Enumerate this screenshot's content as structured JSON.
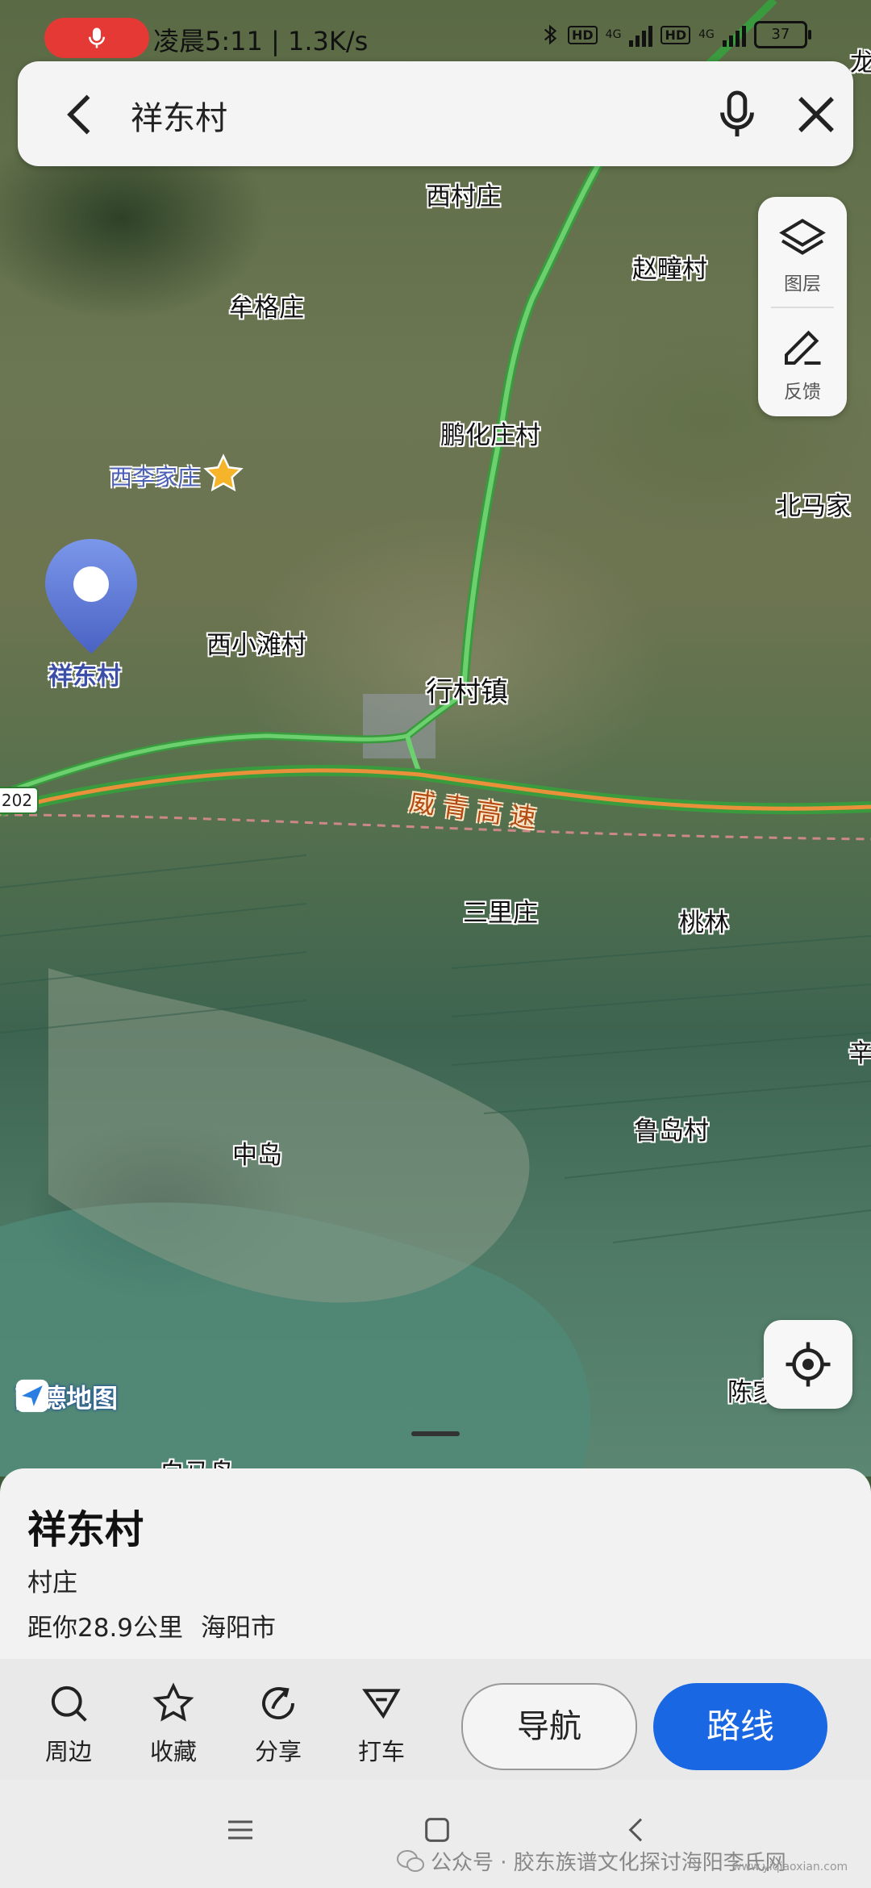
{
  "status_bar": {
    "time_speed": "凌晨5:11 | 1.3K/s",
    "hd": "HD",
    "net": "4G",
    "battery": "37"
  },
  "search": {
    "query": "祥东村",
    "icons": [
      "back-icon",
      "mic-icon",
      "close-icon"
    ]
  },
  "map_labels": {
    "xicunzhuang": "西村庄",
    "zhaotongcun": "赵疃村",
    "mougezhuang": "牟格庄",
    "penghuazhuangcun": "鹏化庄村",
    "xilijiazhuang": "西李家庄",
    "beimajia": "北马家",
    "xixiaotancun": "西小滩村",
    "xingcunzhen": "行村镇",
    "weiqinggaosu": "威青高速",
    "road_shield": "202",
    "sanlizhuang": "三里庄",
    "taolin": "桃林",
    "xin": "辛",
    "ludaocun": "鲁岛村",
    "zhongdao": "中岛",
    "chenjia": "陈家",
    "baimadao": "白马岛",
    "long": "龙",
    "pin_label": "祥东村"
  },
  "map_controls": {
    "layer_label": "图层",
    "feedback_label": "反馈",
    "amap_logo": "高德地图"
  },
  "place_card": {
    "title": "祥东村",
    "category": "村庄",
    "distance": "距你28.9公里",
    "city": "海阳市"
  },
  "actions": {
    "nearby": "周边",
    "favorite": "收藏",
    "share": "分享",
    "taxi": "打车",
    "navigate": "导航",
    "route": "路线"
  },
  "watermark": {
    "text": "公众号 · 胶东族谱文化探讨海阳李氏网",
    "url": "www.yiqiaoxian.com"
  },
  "colors": {
    "route_button": "#1a67e4",
    "highway_green": "#4caf50",
    "highway_orange": "#e8913a",
    "pin_blue": "#5b79d6",
    "mic_pill_red": "#e53935"
  }
}
